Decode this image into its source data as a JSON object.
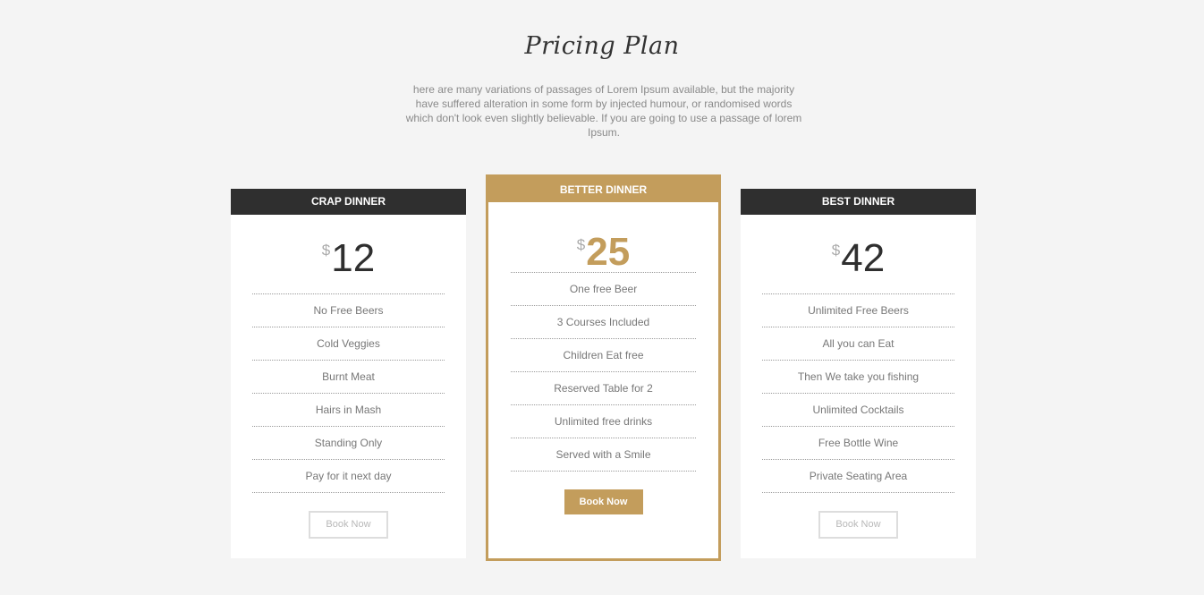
{
  "section": {
    "title": "Pricing Plan",
    "intro": "here are many variations of passages of Lorem Ipsum available, but the majority have suffered alteration in some form by injected humour, or randomised words which don't look even slightly believable. If you are going to use a passage of lorem Ipsum."
  },
  "colors": {
    "accent": "#c39d5c",
    "dark": "#2f2f2f",
    "background": "#f4f4f4"
  },
  "plans": [
    {
      "name": "CRAP DINNER",
      "currency": "$",
      "price": "12",
      "features": [
        "No Free Beers",
        "Cold Veggies",
        "Burnt Meat",
        "Hairs in Mash",
        "Standing Only",
        "Pay for it next day"
      ],
      "button": "Book Now"
    },
    {
      "name": "BETTER DINNER",
      "currency": "$",
      "price": "25",
      "features": [
        "One free Beer",
        "3 Courses Included",
        "Children Eat free",
        "Reserved Table for 2",
        "Unlimited free drinks",
        "Served with a Smile"
      ],
      "button": "Book Now"
    },
    {
      "name": "BEST DINNER",
      "currency": "$",
      "price": "42",
      "features": [
        "Unlimited Free Beers",
        "All you can Eat",
        "Then We take you fishing",
        "Unlimited Cocktails",
        "Free Bottle Wine",
        "Private Seating Area"
      ],
      "button": "Book Now"
    }
  ]
}
